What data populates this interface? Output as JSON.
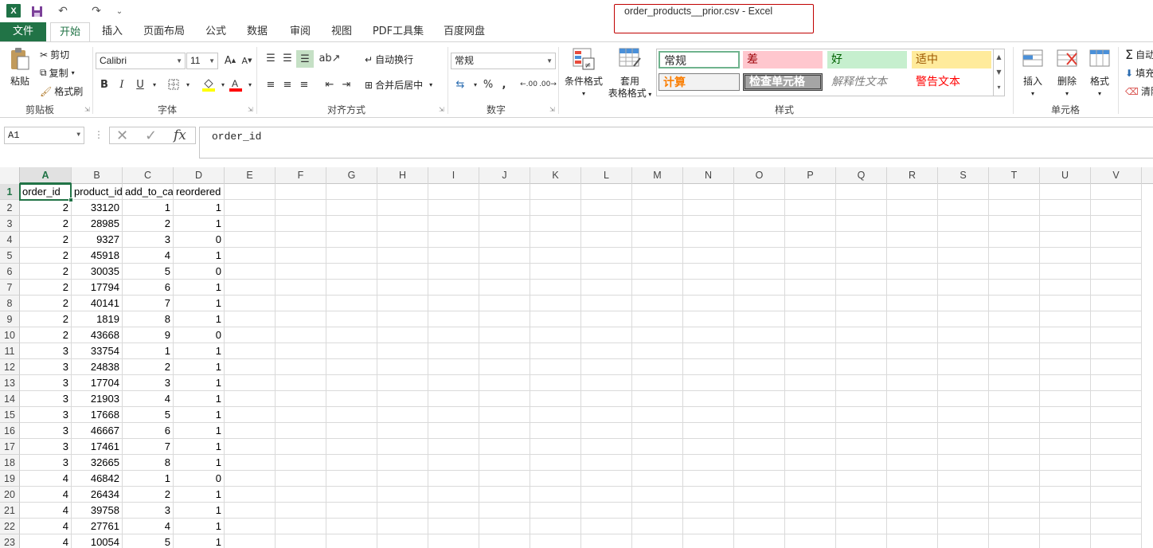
{
  "window": {
    "title": "order_products__prior.csv - Excel",
    "app_icon": "X"
  },
  "quick_access": {
    "save_icon": "💾",
    "undo_icon": "↶",
    "redo_icon": "↷",
    "customize_icon": "⌄"
  },
  "tabs": [
    "文件",
    "开始",
    "插入",
    "页面布局",
    "公式",
    "数据",
    "审阅",
    "视图",
    "PDF工具集",
    "百度网盘"
  ],
  "ribbon": {
    "clipboard": {
      "paste": "粘贴",
      "cut": "剪切",
      "copy": "复制",
      "format_painter": "格式刷",
      "label": "剪贴板"
    },
    "font": {
      "name": "Calibri",
      "size": "11",
      "label": "字体",
      "bold": "B",
      "italic": "I",
      "underline": "U",
      "grow": "A",
      "shrink": "A"
    },
    "alignment": {
      "wrap": "自动换行",
      "merge": "合并后居中",
      "label": "对齐方式"
    },
    "number": {
      "format": "常规",
      "label": "数字",
      "percent": "%",
      "comma": ",",
      "inc_decimal": ".00",
      "dec_decimal": ".00"
    },
    "styles": {
      "conditional": "条件格式",
      "table_format_1": "套用",
      "table_format_2": "表格格式",
      "label": "样式",
      "cells": [
        {
          "text": "常规",
          "bg": "#ffffff",
          "color": "#000000"
        },
        {
          "text": "差",
          "bg": "#ffc7ce",
          "color": "#9c0006"
        },
        {
          "text": "好",
          "bg": "#c6efce",
          "color": "#006100"
        },
        {
          "text": "适中",
          "bg": "#ffeb9c",
          "color": "#9c5700"
        },
        {
          "text": "计算",
          "bg": "#f2f2f2",
          "color": "#fa7d00"
        },
        {
          "text": "检查单元格",
          "bg": "#a5a5a5",
          "color": "#ffffff"
        },
        {
          "text": "解释性文本",
          "bg": "#ffffff",
          "color": "#7f7f7f"
        },
        {
          "text": "警告文本",
          "bg": "#ffffff",
          "color": "#ff0000"
        }
      ]
    },
    "cells_group": {
      "insert": "插入",
      "delete": "删除",
      "format": "格式",
      "label": "单元格"
    },
    "editing": {
      "autosum": "自动",
      "fill": "填充",
      "clear": "清除"
    }
  },
  "formula_bar": {
    "name_box": "A1",
    "content": "order_id",
    "fx": "fx"
  },
  "columns": [
    "A",
    "B",
    "C",
    "D",
    "E",
    "F",
    "G",
    "H",
    "I",
    "J",
    "K",
    "L",
    "M",
    "N",
    "O",
    "P",
    "Q",
    "R",
    "S",
    "T",
    "U",
    "V"
  ],
  "header_row": [
    "order_id",
    "product_id",
    "add_to_cart_order",
    "reordered"
  ],
  "rows": [
    [
      "2",
      "33120",
      "1",
      "1"
    ],
    [
      "2",
      "28985",
      "2",
      "1"
    ],
    [
      "2",
      "9327",
      "3",
      "0"
    ],
    [
      "2",
      "45918",
      "4",
      "1"
    ],
    [
      "2",
      "30035",
      "5",
      "0"
    ],
    [
      "2",
      "17794",
      "6",
      "1"
    ],
    [
      "2",
      "40141",
      "7",
      "1"
    ],
    [
      "2",
      "1819",
      "8",
      "1"
    ],
    [
      "2",
      "43668",
      "9",
      "0"
    ],
    [
      "3",
      "33754",
      "1",
      "1"
    ],
    [
      "3",
      "24838",
      "2",
      "1"
    ],
    [
      "3",
      "17704",
      "3",
      "1"
    ],
    [
      "3",
      "21903",
      "4",
      "1"
    ],
    [
      "3",
      "17668",
      "5",
      "1"
    ],
    [
      "3",
      "46667",
      "6",
      "1"
    ],
    [
      "3",
      "17461",
      "7",
      "1"
    ],
    [
      "3",
      "32665",
      "8",
      "1"
    ],
    [
      "4",
      "46842",
      "1",
      "0"
    ],
    [
      "4",
      "26434",
      "2",
      "1"
    ],
    [
      "4",
      "39758",
      "3",
      "1"
    ],
    [
      "4",
      "27761",
      "4",
      "1"
    ],
    [
      "4",
      "10054",
      "5",
      "1"
    ]
  ],
  "row_numbers": [
    "1",
    "2",
    "3",
    "4",
    "5",
    "6",
    "7",
    "8",
    "9",
    "10",
    "11",
    "12",
    "13",
    "14",
    "15",
    "16",
    "17",
    "18",
    "19",
    "20",
    "21",
    "22",
    "23"
  ]
}
